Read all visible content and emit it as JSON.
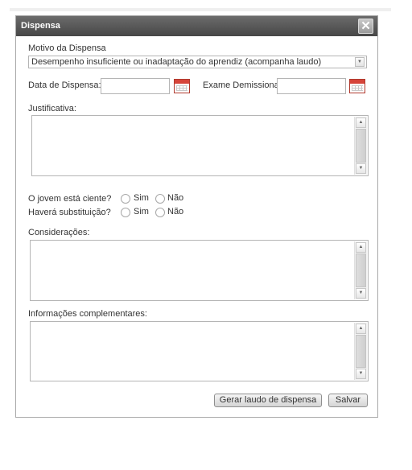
{
  "dialog": {
    "title": "Dispensa",
    "close_glyph": "✕"
  },
  "motivo": {
    "label": "Motivo da Dispensa",
    "selected": "Desempenho insuficiente ou inadaptação do aprendiz (acompanha laudo)"
  },
  "data_dispensa": {
    "label": "Data de Dispensa:",
    "value": ""
  },
  "exame": {
    "label": "Exame Demissional:",
    "value": ""
  },
  "justificativa": {
    "label": "Justificativa:",
    "value": ""
  },
  "ciente": {
    "question": "O jovem está ciente?",
    "yes": "Sim",
    "no": "Não"
  },
  "substituicao": {
    "question": "Haverá substituição?",
    "yes": "Sim",
    "no": "Não"
  },
  "consideracoes": {
    "label": "Considerações:",
    "value": ""
  },
  "informacoes": {
    "label": "Informações complementares:",
    "value": ""
  },
  "buttons": {
    "gerar": "Gerar laudo de dispensa",
    "salvar": "Salvar"
  },
  "icons": {
    "close": "close-icon",
    "dropdown": "chevron-down-icon",
    "calendar": "calendar-icon",
    "scroll_up": "scroll-up-icon",
    "scroll_down": "scroll-down-icon"
  }
}
